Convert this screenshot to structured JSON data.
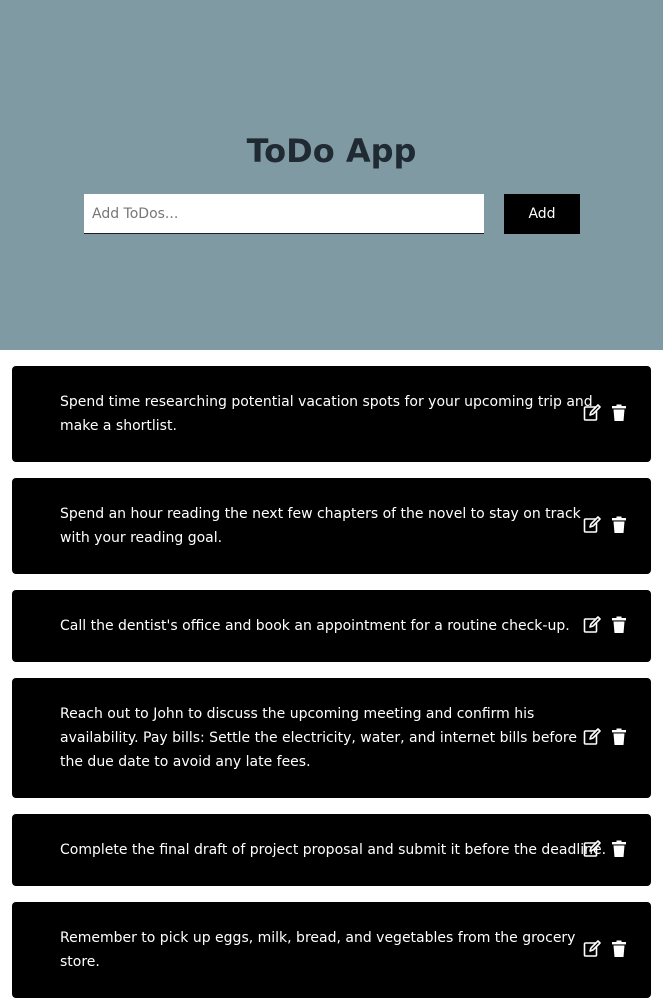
{
  "header": {
    "title": "ToDo App",
    "input_placeholder": "Add ToDos...",
    "input_value": "",
    "add_label": "Add",
    "background": "#809aa4"
  },
  "todos": [
    {
      "text": "Spend time researching potential vacation spots for your upcoming trip and make a shortlist."
    },
    {
      "text": "Spend an hour reading the next few chapters of the novel to stay on track with your reading goal."
    },
    {
      "text": "Call the dentist's office and book an appointment for a routine check-up."
    },
    {
      "text": "Reach out to John to discuss the upcoming meeting and confirm his availability. Pay bills: Settle the electricity, water, and internet bills before the due date to avoid any late fees."
    },
    {
      "text": "Complete the final draft of project proposal and submit it before the deadline."
    },
    {
      "text": "Remember to pick up eggs, milk, bread, and vegetables from the grocery store."
    }
  ],
  "icons": {
    "edit": "edit-icon",
    "delete": "trash-icon"
  }
}
